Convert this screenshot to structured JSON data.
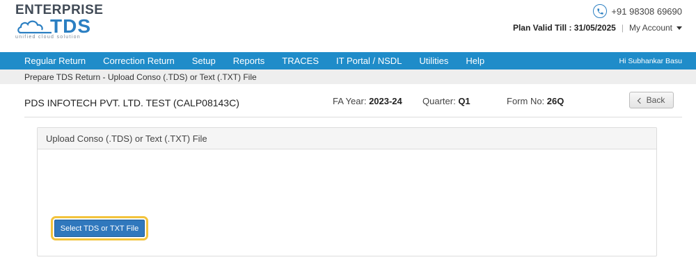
{
  "logo": {
    "top_text": "ENTERPRISE",
    "main_text": "TDS",
    "tagline": "unified cloud solution"
  },
  "contact": {
    "phone": "+91 98308 69690"
  },
  "plan": {
    "text": "Plan Valid Till : 31/05/2025",
    "separator": "|",
    "account_label": "My Account"
  },
  "nav": {
    "items": [
      {
        "label": "Regular Return"
      },
      {
        "label": "Correction Return"
      },
      {
        "label": "Setup"
      },
      {
        "label": "Reports"
      },
      {
        "label": "TRACES"
      },
      {
        "label": "IT Portal / NSDL"
      },
      {
        "label": "Utilities"
      },
      {
        "label": "Help"
      }
    ],
    "greeting": "Hi Subhankar Basu"
  },
  "breadcrumb": "Prepare TDS Return - Upload Conso (.TDS) or Text (.TXT) File",
  "info": {
    "company": "PDS INFOTECH PVT. LTD. TEST (CALP08143C)",
    "fa_year_label": "FA Year:",
    "fa_year_value": "2023-24",
    "quarter_label": "Quarter:",
    "quarter_value": "Q1",
    "form_label": "Form No:",
    "form_value": "26Q",
    "back_label": "Back"
  },
  "panel": {
    "title": "Upload Conso (.TDS) or Text (.TXT) File",
    "select_button": "Select TDS or TXT File"
  },
  "colors": {
    "nav_bg": "#1f8cc9",
    "brand_blue": "#2b7fc2",
    "button_blue": "#3078bd",
    "highlight": "#f3c33c"
  }
}
